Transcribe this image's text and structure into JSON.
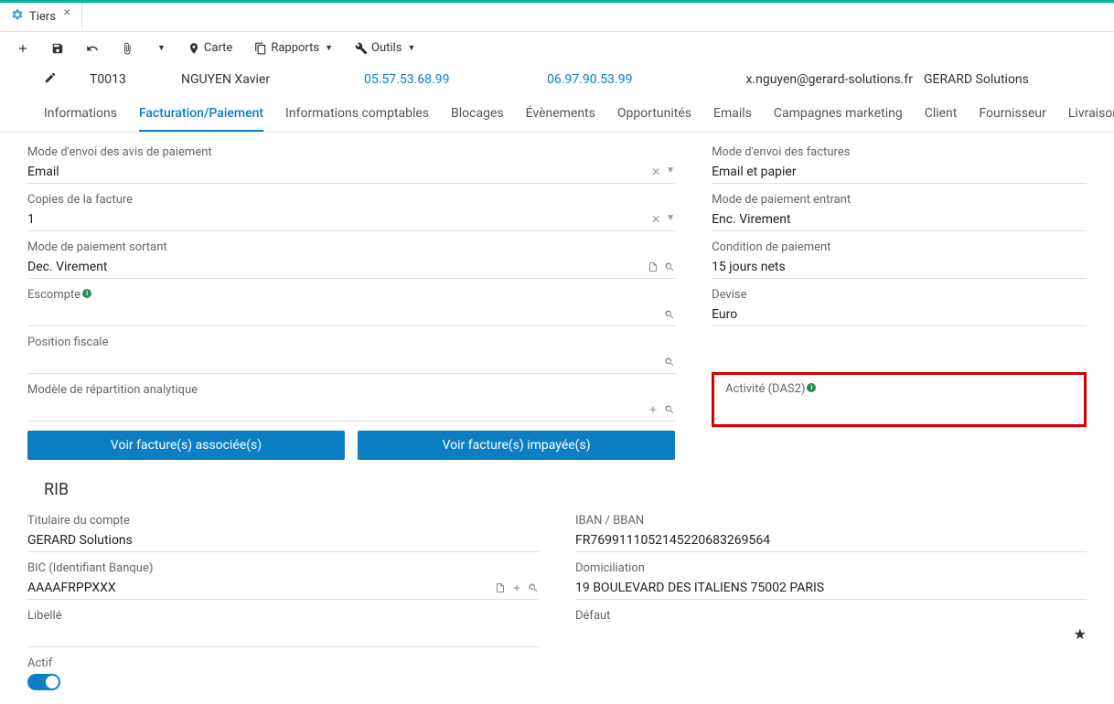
{
  "window_tab": {
    "label": "Tiers"
  },
  "toolbar": {
    "carte": "Carte",
    "rapports": "Rapports",
    "outils": "Outils"
  },
  "contact": {
    "code": "T0013",
    "name": "NGUYEN Xavier",
    "tel": "05.57.53.68.99",
    "mobile": "06.97.90.53.99",
    "email": "x.nguyen@gerard-solutions.fr",
    "company": "GERARD Solutions"
  },
  "sub_tabs": [
    "Informations",
    "Facturation/Paiement",
    "Informations comptables",
    "Blocages",
    "Évènements",
    "Opportunités",
    "Emails",
    "Campagnes marketing",
    "Client",
    "Fournisseur",
    "Livraison"
  ],
  "left_fields": {
    "mode_envoi_avis": {
      "label": "Mode d'envoi des avis de paiement",
      "value": "Email"
    },
    "copies_facture": {
      "label": "Copies de la facture",
      "value": "1"
    },
    "mode_paiement_sortant": {
      "label": "Mode de paiement sortant",
      "value": "Dec. Virement"
    },
    "escompte": {
      "label": "Escompte",
      "value": ""
    },
    "position_fiscale": {
      "label": "Position fiscale",
      "value": ""
    },
    "modele_repartition": {
      "label": "Modèle de répartition analytique",
      "value": ""
    }
  },
  "right_fields": {
    "mode_envoi_factures": {
      "label": "Mode d'envoi des factures",
      "value": "Email et papier"
    },
    "mode_paiement_entrant": {
      "label": "Mode de paiement entrant",
      "value": "Enc. Virement"
    },
    "condition_paiement": {
      "label": "Condition de paiement",
      "value": "15 jours nets"
    },
    "devise": {
      "label": "Devise",
      "value": "Euro"
    },
    "activite_das2": {
      "label": "Activité (DAS2)",
      "value": ""
    }
  },
  "buttons": {
    "voir_associee": "Voir facture(s) associée(s)",
    "voir_impayee": "Voir facture(s) impayée(s)"
  },
  "rib": {
    "title": "RIB",
    "titulaire": {
      "label": "Titulaire du compte",
      "value": "GERARD Solutions"
    },
    "bic": {
      "label": "BIC (Identifiant Banque)",
      "value": "AAAAFRPPXXX"
    },
    "libelle": {
      "label": "Libellé",
      "value": ""
    },
    "iban": {
      "label": "IBAN / BBAN",
      "value": "FR7699111052145220683269564"
    },
    "domiciliation": {
      "label": "Domiciliation",
      "value": "19 BOULEVARD DES ITALIENS 75002 PARIS"
    },
    "defaut": {
      "label": "Défaut"
    },
    "actif": {
      "label": "Actif"
    }
  }
}
